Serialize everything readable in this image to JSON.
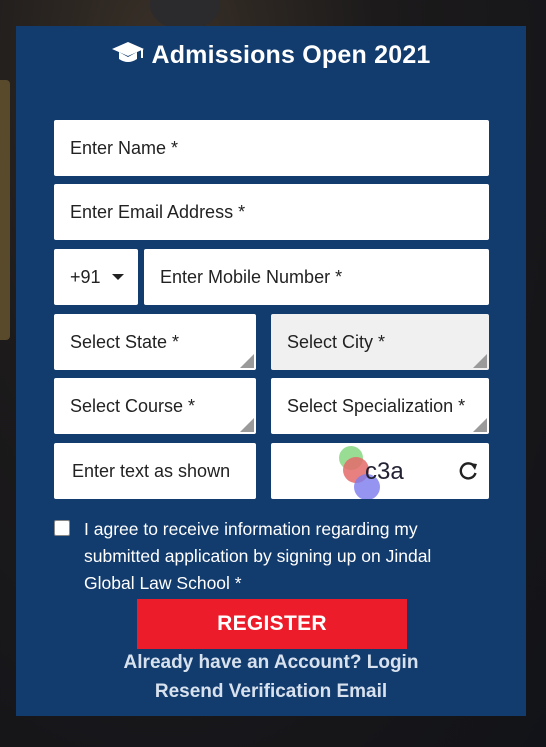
{
  "header": {
    "title": "Admissions Open 2021",
    "icon": "graduation-cap-icon"
  },
  "form": {
    "name_placeholder": "Enter Name *",
    "email_placeholder": "Enter Email Address *",
    "country_code": "+91",
    "mobile_placeholder": "Enter Mobile Number *",
    "state_placeholder": "Select State *",
    "city_placeholder": "Select City *",
    "course_placeholder": "Select Course *",
    "specialization_placeholder": "Select Specialization *",
    "captcha_placeholder": "Enter text as shown",
    "captcha_text": "c3a",
    "refresh_icon": "refresh-icon"
  },
  "consent": {
    "label": "I agree to receive information regarding my submitted application by signing up on Jindal Global Law School *",
    "checked": false
  },
  "actions": {
    "register_label": "REGISTER",
    "login_link": "Already have an Account? Login",
    "resend_link": "Resend Verification Email"
  },
  "colors": {
    "card_bg": "#123b6e",
    "register_bg": "#ed1c2a",
    "link_color": "#d8e2ee"
  }
}
